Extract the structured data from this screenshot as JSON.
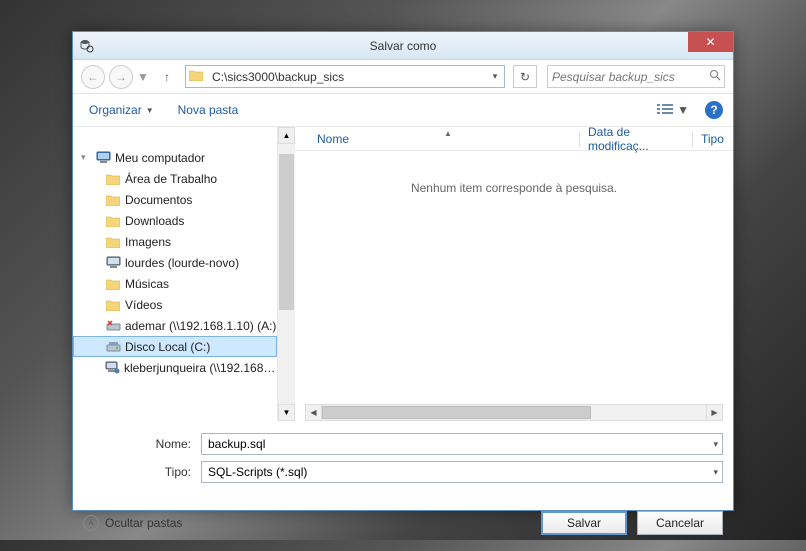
{
  "title": "Salvar como",
  "nav": {
    "path": "C:\\sics3000\\backup_sics"
  },
  "search": {
    "placeholder": "Pesquisar backup_sics"
  },
  "toolbar": {
    "organize": "Organizar",
    "new_folder": "Nova pasta"
  },
  "tree": {
    "root": "Meu computador",
    "items": [
      {
        "label": "Área de Trabalho",
        "icon": "folder"
      },
      {
        "label": "Documentos",
        "icon": "folder"
      },
      {
        "label": "Downloads",
        "icon": "folder"
      },
      {
        "label": "Imagens",
        "icon": "folder"
      },
      {
        "label": "lourdes (lourde-novo)",
        "icon": "computer"
      },
      {
        "label": "Músicas",
        "icon": "folder"
      },
      {
        "label": "Vídeos",
        "icon": "folder"
      },
      {
        "label": "ademar (\\\\192.168.1.10) (A:)",
        "icon": "netdrive-x"
      },
      {
        "label": "Disco Local (C:)",
        "icon": "drive",
        "selected": true
      },
      {
        "label": "kleberjunqueira (\\\\192.168.1...",
        "icon": "netcomp"
      }
    ]
  },
  "list": {
    "columns": {
      "name": "Nome",
      "modified": "Data de modificaç...",
      "type": "Tipo"
    },
    "empty_message": "Nenhum item corresponde à pesquisa."
  },
  "form": {
    "name_label": "Nome:",
    "name_value": "backup.sql",
    "type_label": "Tipo:",
    "type_value": "SQL-Scripts (*.sql)"
  },
  "footer": {
    "hide_folders": "Ocultar pastas",
    "save": "Salvar",
    "cancel": "Cancelar"
  }
}
